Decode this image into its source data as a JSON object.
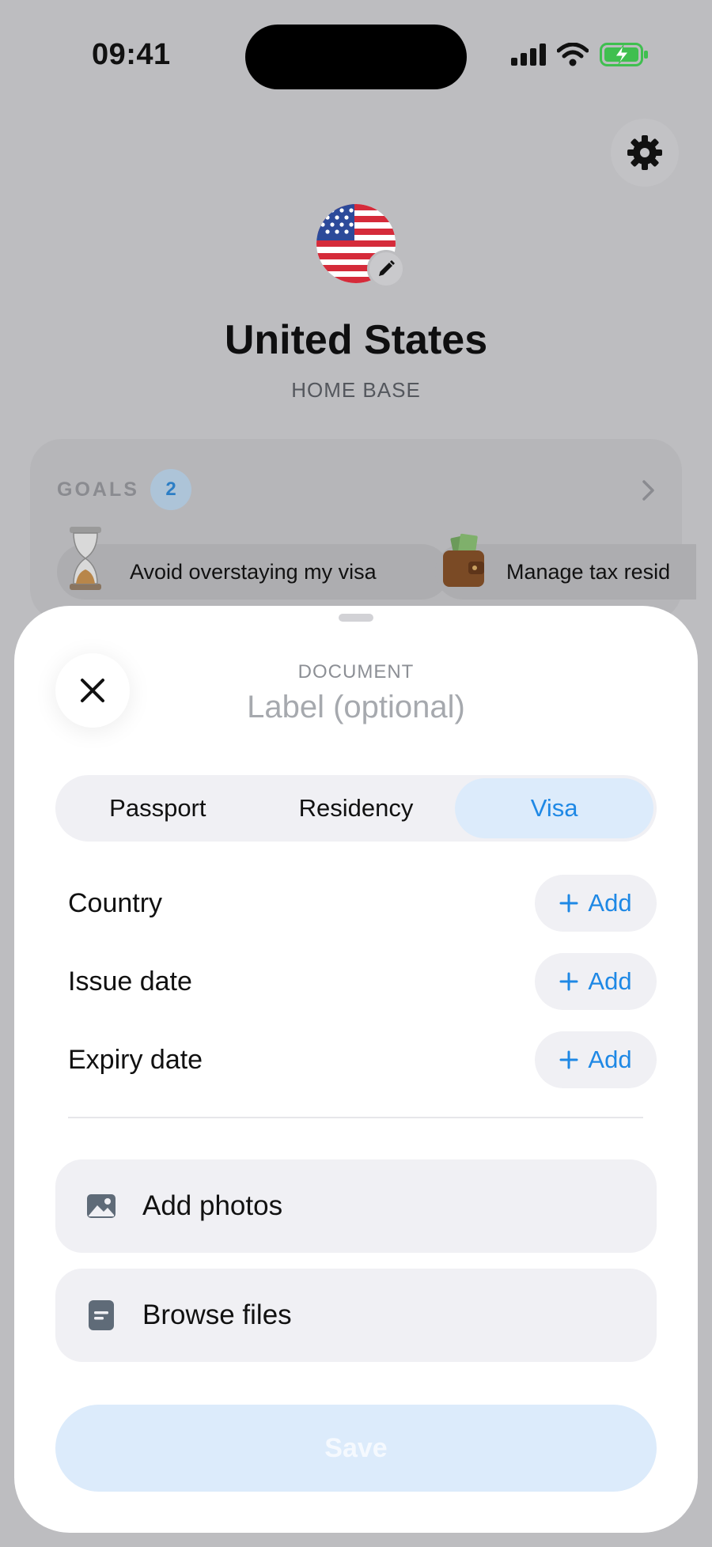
{
  "status_bar": {
    "time": "09:41"
  },
  "header": {
    "country": "United States",
    "subtitle": "HOME BASE"
  },
  "goals": {
    "label": "GOALS",
    "count": "2",
    "items": [
      {
        "label": "Avoid overstaying my visa",
        "icon": "hourglass-icon"
      },
      {
        "label": "Manage tax resid",
        "icon": "wallet-icon"
      }
    ]
  },
  "sheet": {
    "kicker": "DOCUMENT",
    "label_placeholder": "Label (optional)",
    "tabs": [
      {
        "label": "Passport",
        "active": false
      },
      {
        "label": "Residency",
        "active": false
      },
      {
        "label": "Visa",
        "active": true
      }
    ],
    "fields": [
      {
        "label": "Country",
        "action": "Add"
      },
      {
        "label": "Issue date",
        "action": "Add"
      },
      {
        "label": "Expiry date",
        "action": "Add"
      }
    ],
    "actions": [
      {
        "label": "Add photos",
        "icon": "image-icon"
      },
      {
        "label": "Browse files",
        "icon": "file-icon"
      }
    ],
    "save_label": "Save"
  },
  "colors": {
    "accent": "#1e88e5",
    "accent_soft": "#dcebfb",
    "sheet_bg": "#ffffff",
    "backdrop": "#bdbdc0"
  }
}
